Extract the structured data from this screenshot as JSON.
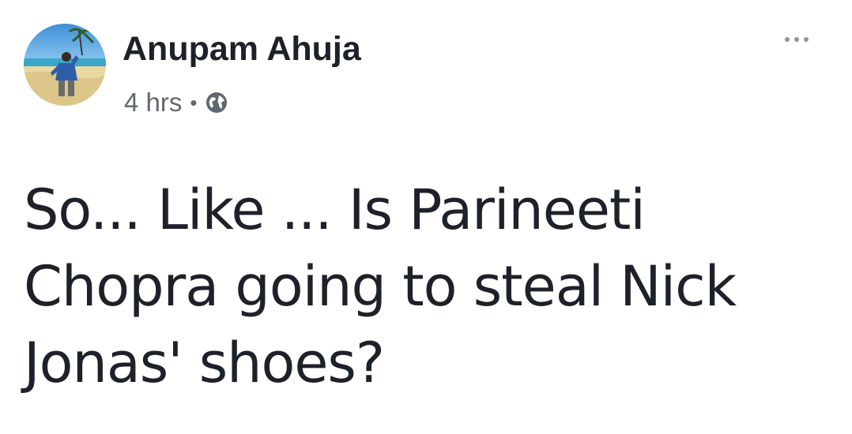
{
  "post": {
    "author": {
      "name": "Anupam Ahuja",
      "avatar_icon": "profile-photo-beach"
    },
    "meta": {
      "timestamp": "4 hrs",
      "separator": "•",
      "privacy_icon": "globe-icon"
    },
    "more_options_icon": "ellipsis-icon",
    "text_lines": [
      "So... Like ... Is Parineeti",
      "Chopra going to steal Nick",
      "Jonas' shoes?"
    ]
  },
  "colors": {
    "text_primary": "#1d2129",
    "text_secondary": "#606770",
    "icon_gray": "#90949c"
  }
}
